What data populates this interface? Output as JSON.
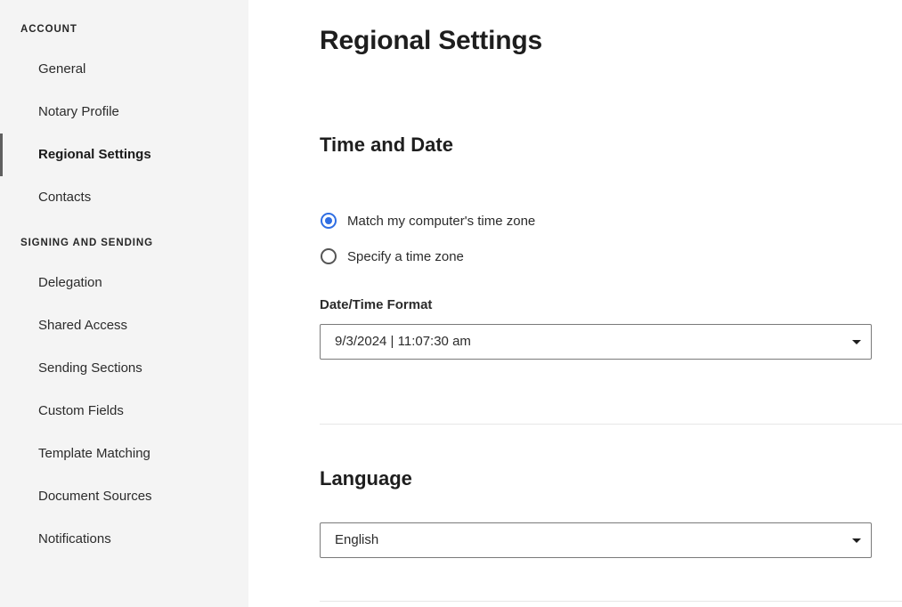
{
  "sidebar": {
    "account_header": "ACCOUNT",
    "account_items": [
      {
        "label": "General"
      },
      {
        "label": "Notary Profile"
      },
      {
        "label": "Regional Settings",
        "active": true
      },
      {
        "label": "Contacts"
      }
    ],
    "signing_header": "SIGNING AND SENDING",
    "signing_items": [
      {
        "label": "Delegation"
      },
      {
        "label": "Shared Access"
      },
      {
        "label": "Sending Sections"
      },
      {
        "label": "Custom Fields"
      },
      {
        "label": "Template Matching"
      },
      {
        "label": "Document Sources"
      },
      {
        "label": "Notifications"
      }
    ]
  },
  "main": {
    "title": "Regional Settings",
    "time_and_date": {
      "heading": "Time and Date",
      "radio_options": [
        {
          "label": "Match my computer's time zone",
          "checked": true
        },
        {
          "label": "Specify a time zone",
          "checked": false
        }
      ],
      "format_label": "Date/Time Format",
      "format_value": "9/3/2024 | 11:07:30 am"
    },
    "language": {
      "heading": "Language",
      "value": "English"
    }
  },
  "colors": {
    "sidebar_bg": "#f4f4f4",
    "accent_radio": "#2f6ee3",
    "active_indicator": "#5f5f5f"
  }
}
